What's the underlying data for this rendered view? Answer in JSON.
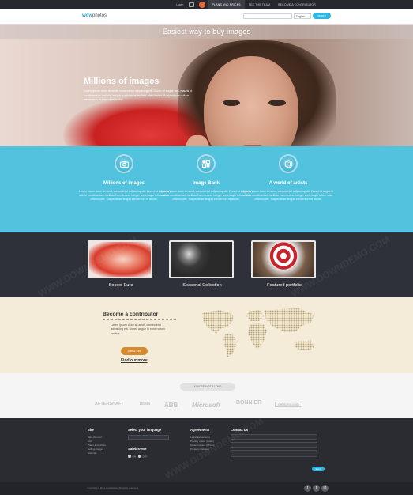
{
  "topbar": {
    "login": "Login",
    "nav": [
      "PLANS AND PRICES",
      "SEE THE TEAM",
      "BECOME A CONTRIBUTOR"
    ]
  },
  "header": {
    "logo_prefix": "wow",
    "logo_suffix": "photos",
    "language": "English",
    "search_button": "search"
  },
  "hero": {
    "tagline": "Easiest way to buy images",
    "title": "Millions of images",
    "text": "Lorem ipsum dolor sit amet, consectetur adipiscing elit. Donec id augue sed, mauris ut condimentum facilisis. Integer scelerisque facilisis. Nam lectus. Suspendisse nullam elementum id dolor urna auctor."
  },
  "features": [
    {
      "icon": "camera-icon",
      "title": "Millions of images",
      "text": "Lorem ipsum dolor sit amet, consectetur adipiscing elit. Donec id augue in nisl, in condimentum facilisis. Nam lectus. Integer scelerisque tellus, vitae ullamcorper. Suspendisse feugiat elementum et auctor."
    },
    {
      "icon": "image-bank-icon",
      "title": "Image Bank",
      "text": "Lorem ipsum dolor sit amet, consectetur adipiscing elit. Donec id augue in nisl, in condimentum facilisis. Nam lectus. Integer scelerisque tellus, vitae ullamcorper. Suspendisse feugiat elementum et auctor."
    },
    {
      "icon": "globe-icon",
      "title": "A world of artists",
      "text": "Lorem ipsum dolor sit amet, consectetur adipiscing elit. Donec id augue in nisl, in condimentum facilisis. Nam lectus. Integer scelerisque tellus, vitae ullamcorper. Suspendisse feugiat elementum et auctor."
    }
  ],
  "gallery": [
    {
      "caption": "Soccer Euro"
    },
    {
      "caption": "Seasonal Collection"
    },
    {
      "caption": "Featured portfolio"
    }
  ],
  "contributor": {
    "title": "Become a contributor",
    "text": "Lorem ipsum dolor sit amet, consectetur adipiscing elit. Donec augue in nunc rutrum facilisis.",
    "button": "Join & Sell",
    "link": "Find our more"
  },
  "partners": {
    "pill": "YOU'RE NOT ALONE",
    "logos": [
      "AFTERSHAFT",
      "nokia",
      "ABB",
      "Microsoft",
      "BONNIER",
      "deltipto.com"
    ]
  },
  "footer": {
    "site_title": "Site",
    "site_links": [
      "Take the tour",
      "FAQ",
      "Plans and prices",
      "Selling images",
      "Sitemap"
    ],
    "language_title": "Select your language",
    "safebrowse_title": "Safebrowse",
    "safebrowse_on": "ON",
    "safebrowse_off": "OFF",
    "agreements_title": "Agreements",
    "agreements_links": [
      "Legal agreements",
      "Privacy notice (IntaG)",
      "Model release (Photo)",
      "Property Release"
    ],
    "contact_title": "Contact Us",
    "send": "Send",
    "copyright": "Copyright © 2011 wowphotos. All rights reserved."
  },
  "colors": {
    "accent": "#52c3df",
    "button_orange": "#d78a2d",
    "dark": "#2e3139",
    "cream": "#f4ecd9"
  }
}
